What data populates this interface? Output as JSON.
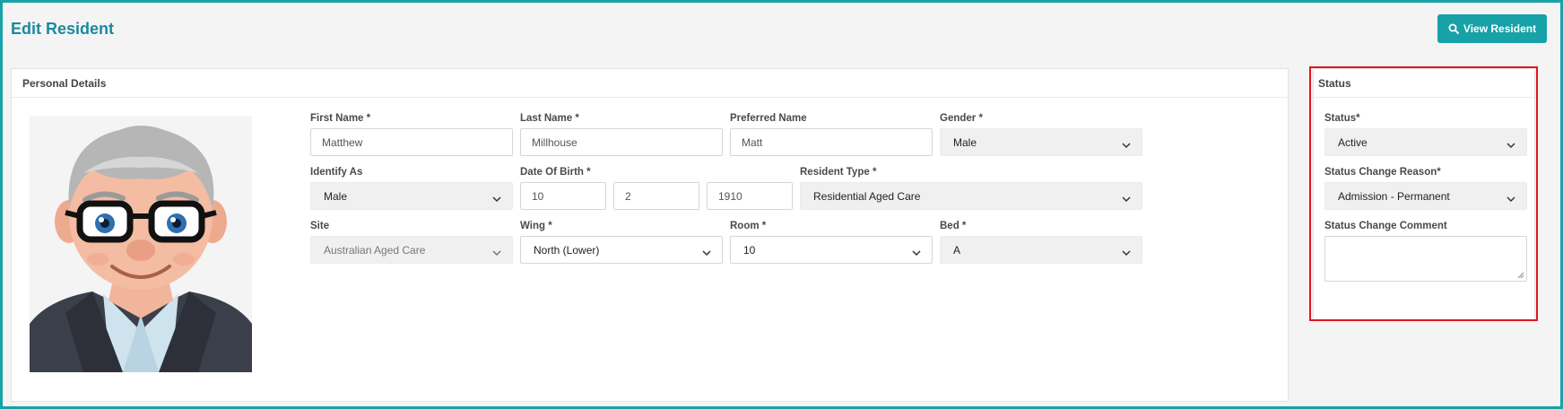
{
  "header": {
    "title": "Edit Resident",
    "view_button_label": "View Resident"
  },
  "personal": {
    "section_title": "Personal Details",
    "fields": {
      "first_name": {
        "label": "First Name *",
        "value": "Matthew"
      },
      "last_name": {
        "label": "Last Name *",
        "value": "Millhouse"
      },
      "preferred_name": {
        "label": "Preferred Name",
        "value": "Matt"
      },
      "gender": {
        "label": "Gender *",
        "value": "Male"
      },
      "identify_as": {
        "label": "Identify As",
        "value": "Male"
      },
      "dob": {
        "label": "Date Of Birth *",
        "day": "10",
        "month": "2",
        "year": "1910"
      },
      "resident_type": {
        "label": "Resident Type *",
        "value": "Residential Aged Care"
      },
      "site": {
        "label": "Site",
        "value": "Australian Aged Care"
      },
      "wing": {
        "label": "Wing *",
        "value": "North (Lower)"
      },
      "room": {
        "label": "Room *",
        "value": "10"
      },
      "bed": {
        "label": "Bed *",
        "value": "A"
      }
    }
  },
  "status": {
    "section_title": "Status",
    "status_label": "Status*",
    "status_value": "Active",
    "reason_label": "Status Change Reason*",
    "reason_value": "Admission - Permanent",
    "comment_label": "Status Change Comment",
    "comment_value": ""
  },
  "colors": {
    "accent": "#17a2a7",
    "title": "#1a8aa0",
    "highlight": "#e3161b"
  }
}
